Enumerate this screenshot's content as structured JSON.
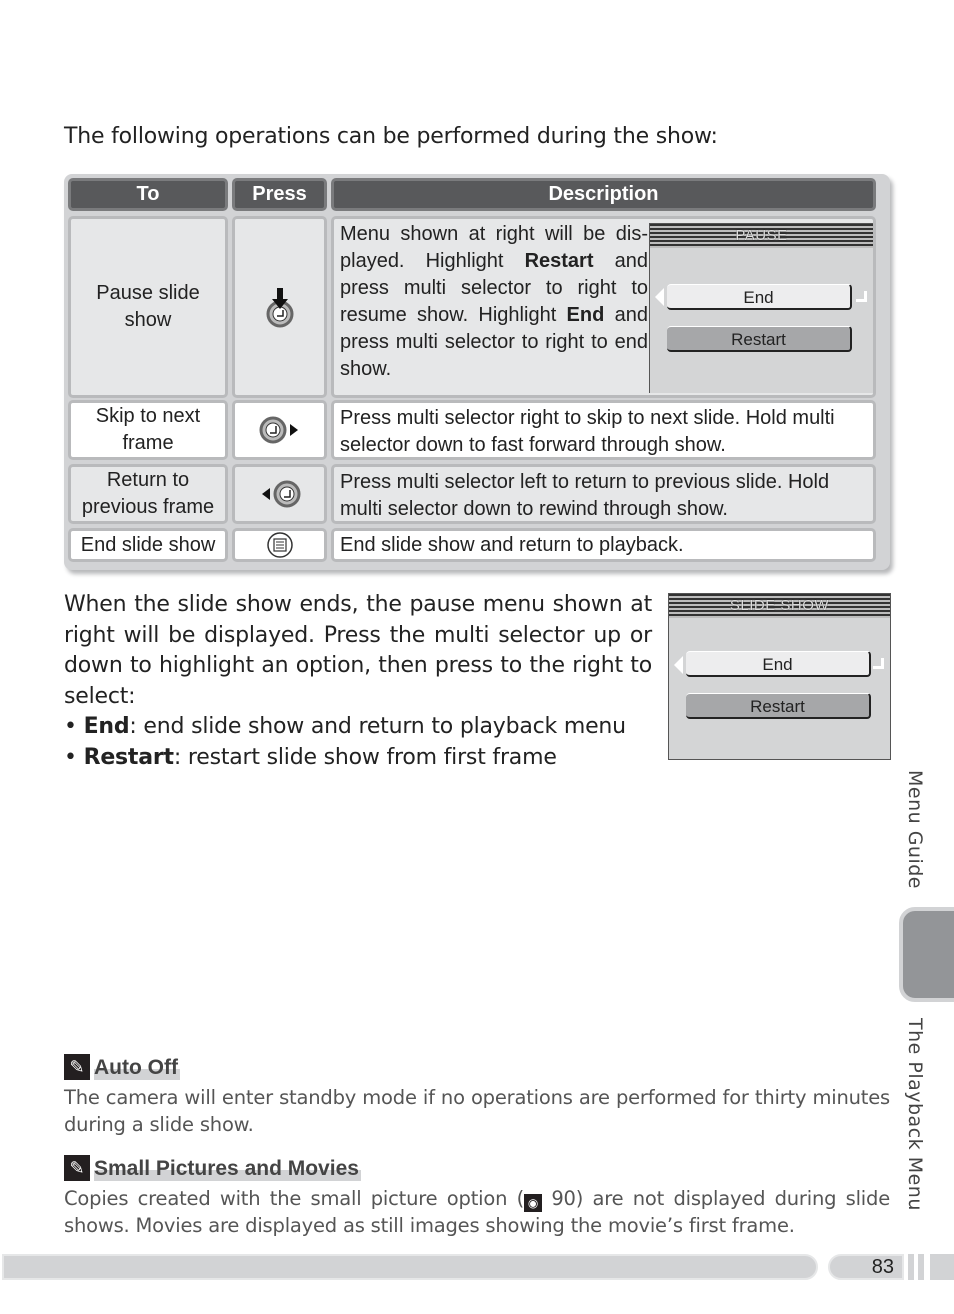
{
  "intro": "The following operations can be performed during the show:",
  "table": {
    "headers": [
      "To",
      "Press",
      "Description"
    ],
    "rows": [
      {
        "to": "Pause slide show",
        "press_icon": "multi-selector-center-press-icon",
        "description_parts": [
          "Menu shown at right will be dis-played. Highlight ",
          "Restart",
          " and press multi selector to right to resume show. Highlight ",
          "End",
          " and press multi selector to right to end show."
        ]
      },
      {
        "to": "Skip to next frame",
        "press_icon": "multi-selector-right-icon",
        "description": "Press multi selector right to skip to next slide.  Hold multi selector down to fast forward through show."
      },
      {
        "to": "Return to previous frame",
        "press_icon": "multi-selector-left-icon",
        "description": "Press multi selector left to return to previous slide.  Hold multi selector down to rewind through show."
      },
      {
        "to": "End slide show",
        "press_icon": "menu-button-icon",
        "description": "End slide show and return to playback."
      }
    ]
  },
  "pause_menu": {
    "title": "PAUSE",
    "options": [
      "End",
      "Restart"
    ],
    "selected": "End"
  },
  "slideshow_menu": {
    "title": "SLIDE SHOW",
    "options": [
      "End",
      "Restart"
    ],
    "selected": "End"
  },
  "paragraph": "When the slide show ends, the pause menu shown at right will be displayed.  Press the multi selector up or down to highlight an option, then press to the right to select:",
  "bullets": [
    {
      "term": "End",
      "text": ": end slide show and return to playback menu"
    },
    {
      "term": "Restart",
      "text": ": restart slide show from first frame"
    }
  ],
  "notes": [
    {
      "title": "Auto Off",
      "text": "The camera will enter standby mode if no operations are performed for thirty minutes during a slide show."
    },
    {
      "title": "Small Pictures and Movies",
      "text_before": "Copies created with the small picture option (",
      "ref_page": "90",
      "text_after": ") are not displayed during slide shows.  Movies are displayed as still images showing the movie’s first frame."
    }
  ],
  "side_tabs": {
    "section": "Menu Guide",
    "chapter": "The Playback Menu"
  },
  "page_number": "83"
}
